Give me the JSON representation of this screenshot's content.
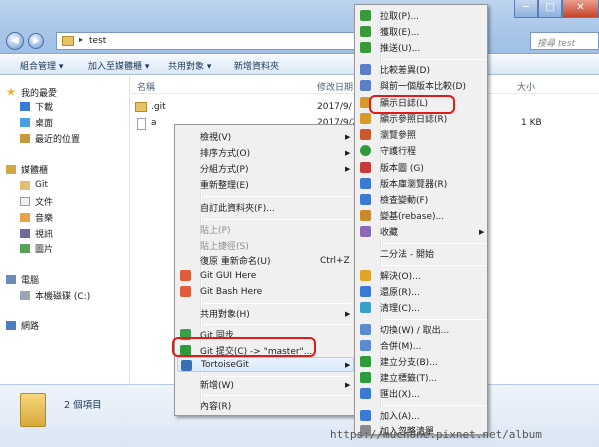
{
  "window": {
    "path": "test",
    "search_placeholder": "搜尋 test",
    "back_glyph": "◀",
    "forward_glyph": "▶",
    "minimize_glyph": "─",
    "maximize_glyph": "□",
    "close_glyph": "✕"
  },
  "toolbar": {
    "organize": "組合管理 ▾",
    "add_to_library": "加入至媒體櫃 ▾",
    "share": "共用對象 ▾",
    "new_folder": "新增資料夾"
  },
  "nav": {
    "favorites": "我的最愛",
    "downloads": "下載",
    "desktop": "桌面",
    "recent": "最近的位置",
    "libraries": "媒體櫃",
    "git": "Git",
    "documents": "文件",
    "music": "音樂",
    "videos": "視訊",
    "pictures": "圖片",
    "computer": "電腦",
    "local_disk": "本機磁碟 (C:)",
    "network": "網路"
  },
  "columns": {
    "name": "名稱",
    "date": "修改日期",
    "size": "大小"
  },
  "files": [
    {
      "name": ".git",
      "date": "2017/9/",
      "size": "",
      "type": "folder"
    },
    {
      "name": "a",
      "date": "2017/9/2",
      "size": "1 KB",
      "type": "file"
    }
  ],
  "status": {
    "count": "2 個項目"
  },
  "context_menu": {
    "view": "檢視(V)",
    "sort_by": "排序方式(O)",
    "group_by": "分組方式(P)",
    "refresh": "重新整理(E)",
    "customize_folder": "自訂此資料夾(F)...",
    "paste": "貼上(P)",
    "paste_shortcut": "貼上捷徑(S)",
    "undo_rename": "復原 重新命名(U)",
    "undo_shortcut": "Ctrl+Z",
    "git_gui": "Git GUI Here",
    "git_bash": "Git Bash Here",
    "share_with": "共用對象(H)",
    "git_sync": "Git 同步...",
    "git_commit": "Git 提交(C) -> \"master\"...",
    "tortoisegit": "TortoiseGit",
    "new": "新增(W)",
    "properties": "內容(R)"
  },
  "tortoise_menu": {
    "pull": "拉取(P)...",
    "fetch": "獲取(E)...",
    "push": "推送(U)...",
    "diff": "比較差異(D)",
    "diff_prev": "與前一個版本比較(D)",
    "show_log": "顯示日誌(L)",
    "ref_log": "顯示參照日誌(R)",
    "browse_refs": "瀏覽參照",
    "daemon": "守護行程",
    "revision_graph": "版本圖 (G)",
    "repo_browser": "版本庫瀏覽器(R)",
    "check_modifications": "檢查變動(F)",
    "rebase": "變基(rebase)...",
    "stash": "收藏",
    "bisect": "二分法 - 開始",
    "resolve": "解決(O)...",
    "revert": "還原(R)...",
    "clean": "清理(C)...",
    "switch_checkout": "切換(W) / 取出...",
    "merge": "合併(M)...",
    "create_branch": "建立分支(B)...",
    "create_tag": "建立標籤(T)...",
    "export": "匯出(X)...",
    "add": "加入(A)...",
    "add_ignore": "加入忽略清單"
  },
  "colors": {
    "highlight_ring": "#e11a1a",
    "accent": "#1e395b"
  },
  "watermark": "https://muchone.pixnet.net/album"
}
